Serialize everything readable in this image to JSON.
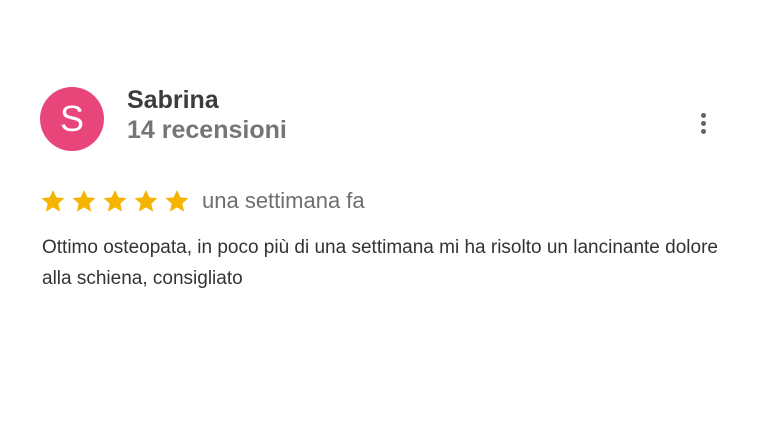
{
  "review": {
    "avatar_letter": "S",
    "avatar_color": "#e8467a",
    "author_name": "Sabrina",
    "author_review_count": "14 recensioni",
    "rating": 5,
    "rating_max": 5,
    "star_color": "#f4b400",
    "date": "una settimana fa",
    "text": "Ottimo osteopata, in poco più di una settimana mi ha risolto un lancinante dolore alla schiena, consigliato"
  },
  "icons": {
    "more": "more-vert-icon",
    "star": "star-icon"
  }
}
